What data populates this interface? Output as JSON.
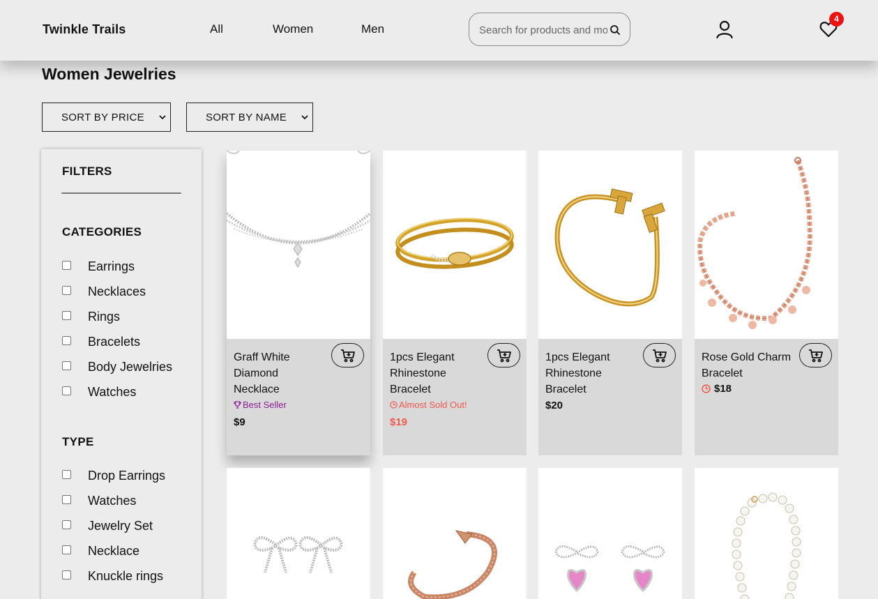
{
  "header": {
    "brand": "Twinkle Trails",
    "nav": [
      "All",
      "Women",
      "Men"
    ],
    "search_placeholder": "Search for products and more",
    "wishlist_count": "4"
  },
  "page": {
    "title": "Women Jewelries",
    "sort_price": "SORT BY PRICE",
    "sort_name": "SORT BY NAME"
  },
  "filters": {
    "title": "FILTERS",
    "categories_title": "CATEGORIES",
    "categories": [
      "Earrings",
      "Necklaces",
      "Rings",
      "Bracelets",
      "Body Jewelries",
      "Watches"
    ],
    "type_title": "TYPE",
    "types": [
      "Drop Earrings",
      "Watches",
      "Jewelry Set",
      "Necklace",
      "Knuckle rings"
    ]
  },
  "products": [
    {
      "name": "Graff White Diamond Necklace",
      "badge": "Best Seller",
      "badge_icon": "trophy-icon",
      "price": "$9"
    },
    {
      "name": "1pcs Elegant Rhinestone Bracelet",
      "badge": "Almost Sold Out!",
      "badge_icon": "clock-icon",
      "price": "$19"
    },
    {
      "name": "1pcs Elegant Rhinestone Bracelet",
      "badge": "",
      "price": "$20"
    },
    {
      "name": "Rose Gold Charm Bracelet",
      "badge": "",
      "badge_icon": "clock-icon",
      "price": "$18"
    }
  ],
  "colors": {
    "background": "#ececec",
    "card_footer": "#d9d9d9",
    "best_seller": "#8d1c96",
    "sold_out": "#f0584a",
    "badge": "#ee1111"
  }
}
